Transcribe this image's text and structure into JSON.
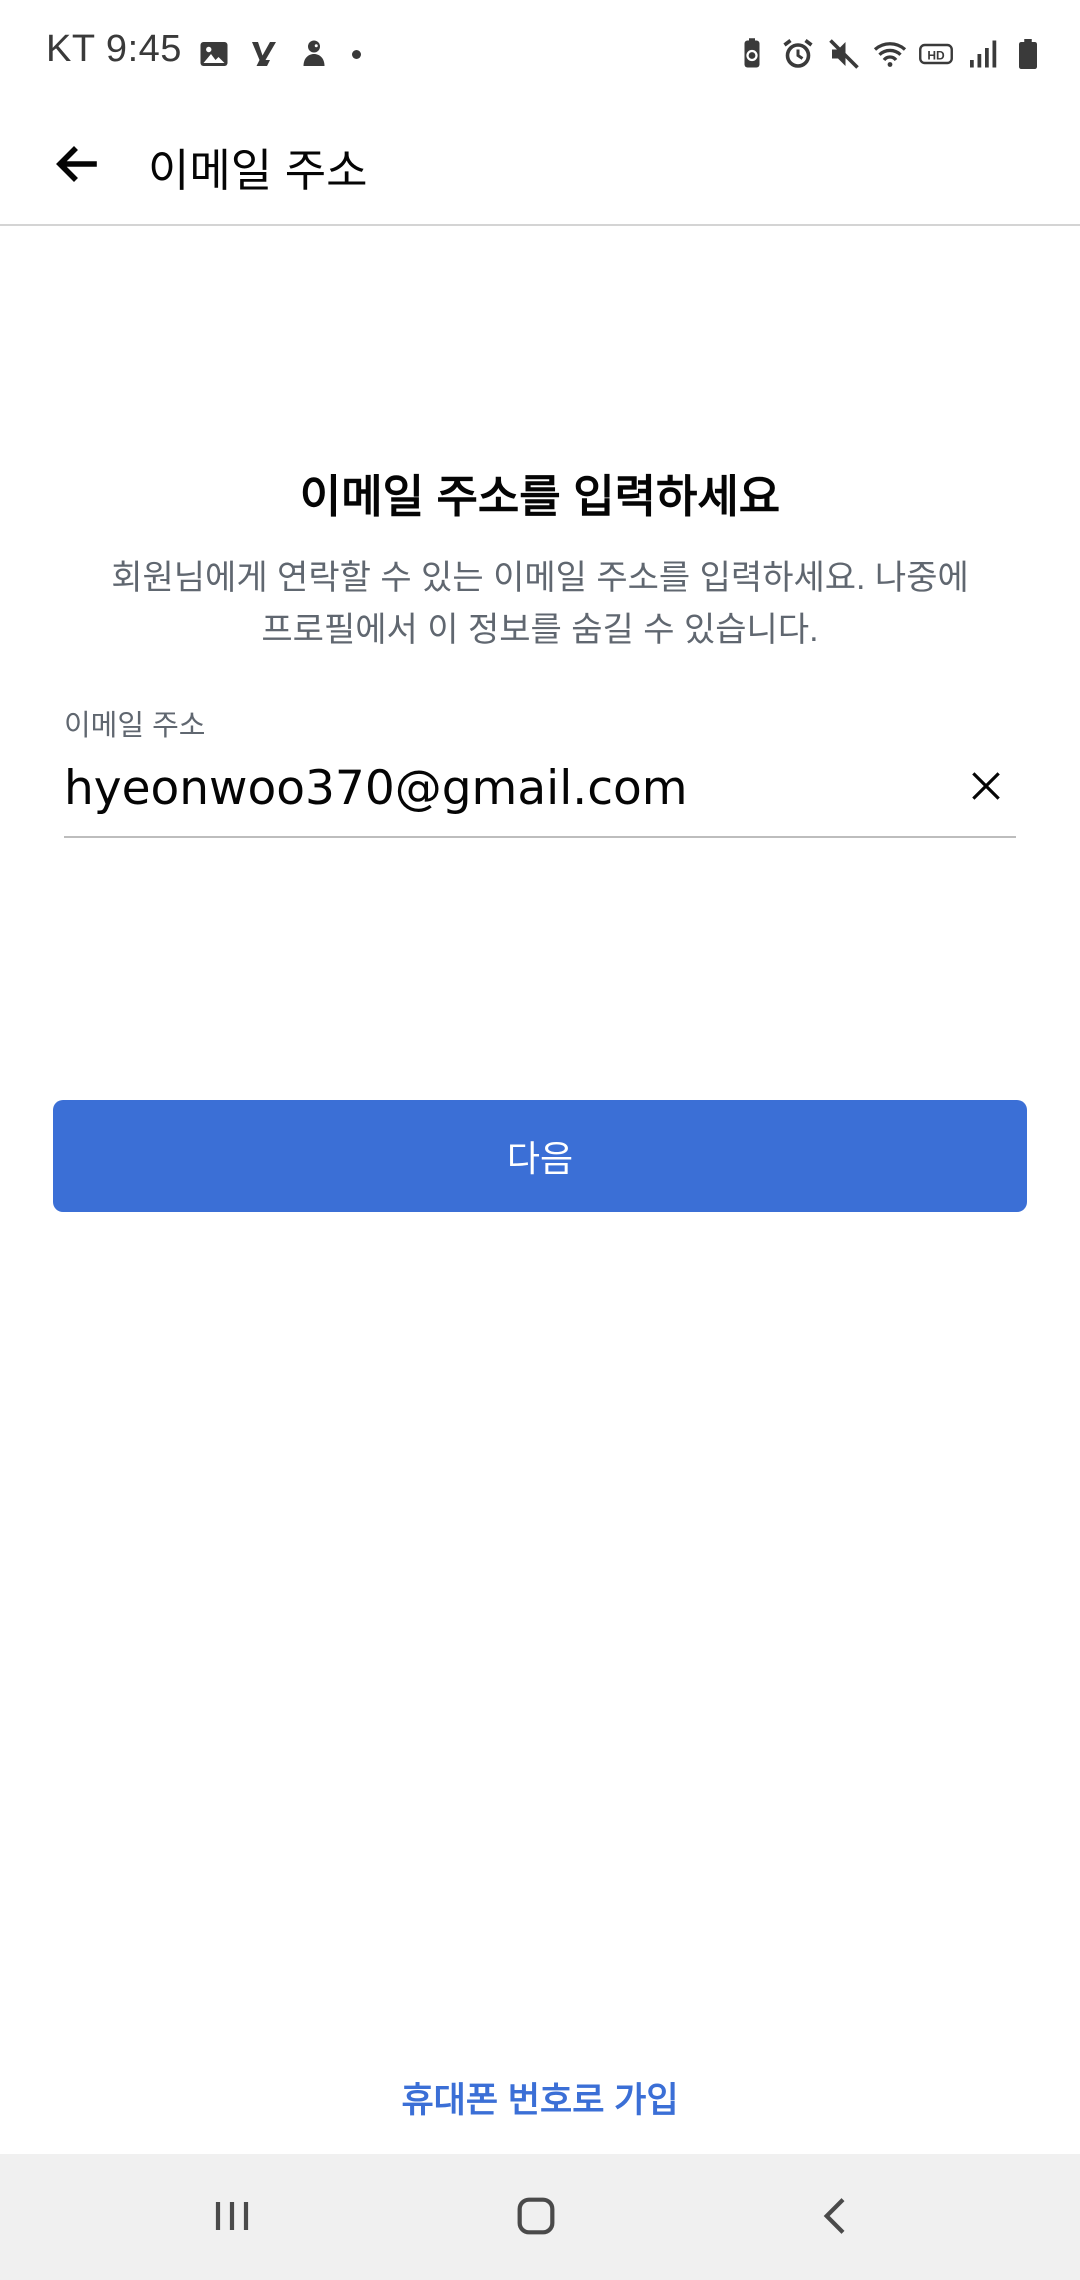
{
  "status_bar": {
    "time": "KT 9:45",
    "left_icons": [
      "gallery-icon",
      "flash-app-icon",
      "duck-app-icon",
      "more-notifications-dot"
    ],
    "right_icons": [
      "battery-saver-icon",
      "alarm-icon",
      "mute-icon",
      "wifi-icon",
      "hd-voice-icon",
      "signal-icon",
      "battery-icon"
    ]
  },
  "app_bar": {
    "back_icon": "arrow-left-icon",
    "title": "이메일 주소"
  },
  "main": {
    "heading": "이메일 주소를 입력하세요",
    "description": "회원님에게 연락할 수 있는 이메일 주소를 입력하세요. 나중에 프로필에서 이 정보를 숨길 수 있습니다.",
    "email_field": {
      "label": "이메일 주소",
      "value": "hyeonwoo370@gmail.com",
      "clear_icon": "close-icon"
    },
    "next_button": "다음",
    "alt_signup_link": "휴대폰 번호로 가입"
  },
  "nav_bar": {
    "recent_icon": "recent-apps-icon",
    "home_icon": "home-icon",
    "back_icon": "back-chevron-icon"
  },
  "colors": {
    "accent": "#3b6fd6",
    "text_primary": "#050505",
    "text_secondary": "#606770",
    "divider": "#d4d4d4",
    "nav_background": "#f0f0f0"
  }
}
